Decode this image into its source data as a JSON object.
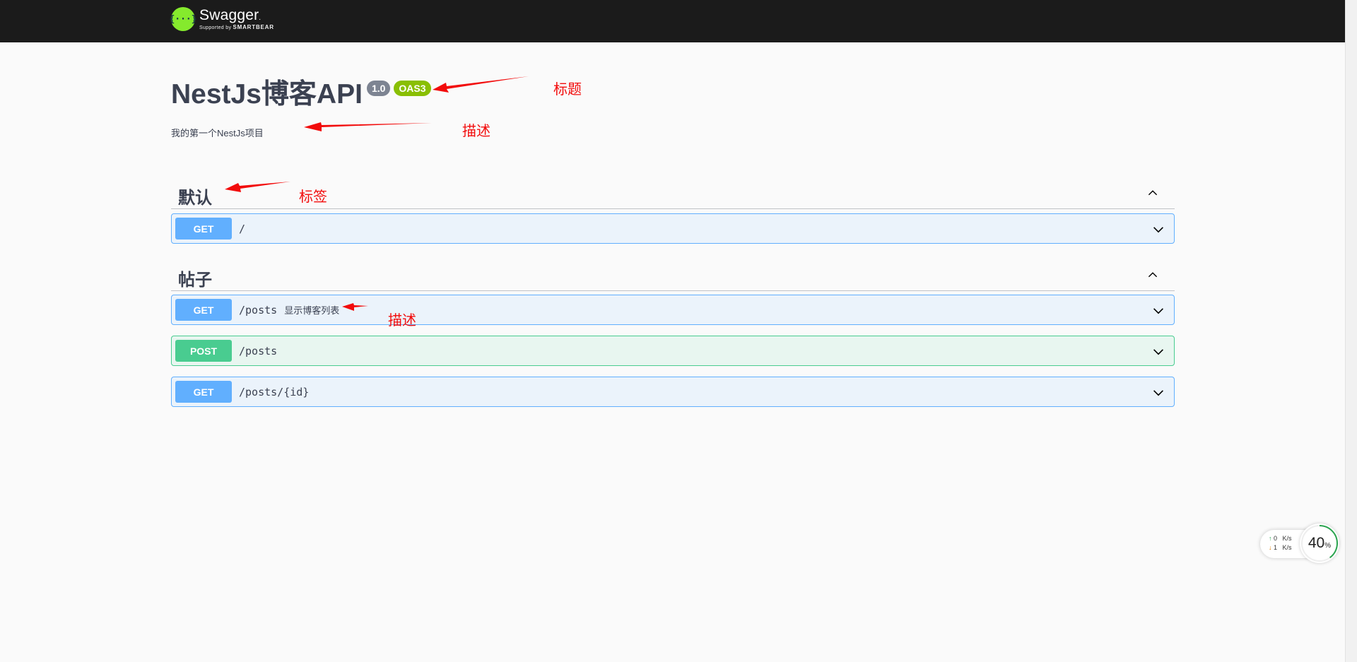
{
  "header": {
    "brand_logo_glyph": "{···}",
    "brand_name": "Swagger",
    "brand_sub_prefix": "Supported by",
    "brand_sub_name": "SMARTBEAR",
    "background": "#1b1b1b",
    "logo_color": "#85ea2d"
  },
  "info": {
    "title": "NestJs博客API",
    "version": "1.0",
    "spec": "OAS3",
    "description": "我的第一个NestJs项目"
  },
  "tags": [
    {
      "name": "默认",
      "toggle_icon": "chevron-up-icon",
      "operations": [
        {
          "method": "GET",
          "path": "/",
          "summary": ""
        }
      ]
    },
    {
      "name": "帖子",
      "toggle_icon": "chevron-up-icon",
      "operations": [
        {
          "method": "GET",
          "path": "/posts",
          "summary": "显示博客列表"
        },
        {
          "method": "POST",
          "path": "/posts",
          "summary": ""
        },
        {
          "method": "GET",
          "path": "/posts/{id}",
          "summary": ""
        }
      ]
    }
  ],
  "annotations": {
    "title_note": "标题",
    "desc_note": "描述",
    "tag_note": "标签",
    "summary_note": "描述",
    "color": "#f20c0c"
  },
  "net_widget": {
    "up_value": "0",
    "up_unit": "K/s",
    "down_value": "1",
    "down_unit": "K/s",
    "percent": "40",
    "percent_unit": "%"
  },
  "colors": {
    "get": "#61affe",
    "post": "#49cc90",
    "get_bg": "#ebf3fb",
    "post_bg": "#e8f6f0"
  }
}
